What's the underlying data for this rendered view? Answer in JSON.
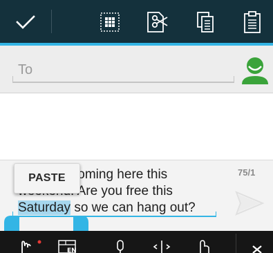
{
  "action_bar": {
    "done": "check-icon",
    "select_all": "select-all-icon",
    "cut": "cut-icon",
    "copy": "copy-icon",
    "paste": "clipboard-icon"
  },
  "recipient": {
    "placeholder": "To",
    "contact_icon": "contact-person-icon"
  },
  "compose": {
    "lines": [
      "s coming here this",
      "weekend. Are you free this"
    ],
    "selected_text": "Saturday",
    "after_selection": " so we can hang out?",
    "char_counter": "75/1",
    "send_icon": "send-icon"
  },
  "popup": {
    "paste_label": "PASTE"
  },
  "keyboard": {
    "keys": [
      "handwriting-icon",
      "language-en-icon",
      "mic-icon",
      "cursor-move-icon",
      "gesture-icon",
      "hide-keyboard-icon"
    ],
    "language_label": "EN"
  },
  "colors": {
    "action_bar": "#14313c",
    "accent": "#33b5e5",
    "selection": "#a6d7ee",
    "contact_green": "#3aa33a"
  }
}
